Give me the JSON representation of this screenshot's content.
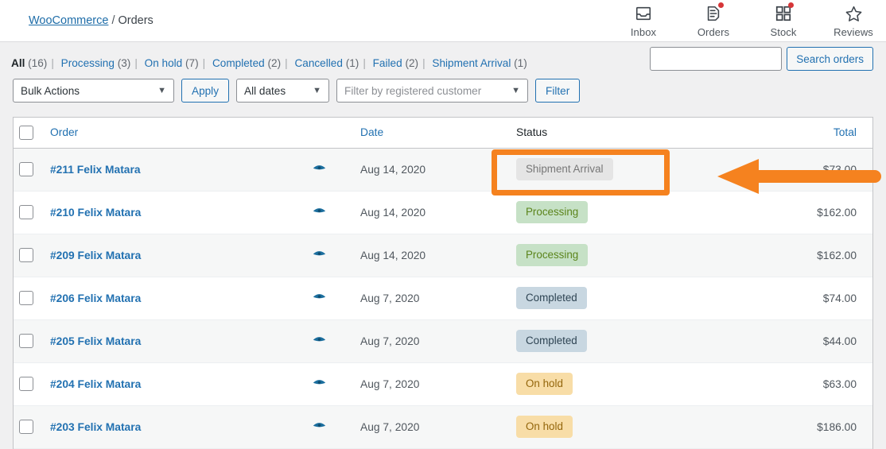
{
  "breadcrumb": {
    "root": "WooCommerce",
    "separator": "/",
    "current": "Orders"
  },
  "nav_icons": [
    {
      "label": "Inbox",
      "icon": "inbox-icon",
      "badge": false
    },
    {
      "label": "Orders",
      "icon": "orders-icon",
      "badge": true
    },
    {
      "label": "Stock",
      "icon": "stock-icon",
      "badge": true
    },
    {
      "label": "Reviews",
      "icon": "star-icon",
      "badge": false
    }
  ],
  "status_filters": [
    {
      "label": "All",
      "count": "(16)",
      "current": true
    },
    {
      "label": "Processing",
      "count": "(3)",
      "current": false
    },
    {
      "label": "On hold",
      "count": "(7)",
      "current": false
    },
    {
      "label": "Completed",
      "count": "(2)",
      "current": false
    },
    {
      "label": "Cancelled",
      "count": "(1)",
      "current": false
    },
    {
      "label": "Failed",
      "count": "(2)",
      "current": false
    },
    {
      "label": "Shipment Arrival",
      "count": "(1)",
      "current": false
    }
  ],
  "search": {
    "value": "",
    "placeholder": "",
    "button_label": "Search orders"
  },
  "toolbar": {
    "bulk_actions_label": "Bulk Actions",
    "apply_label": "Apply",
    "dates_label": "All dates",
    "customer_placeholder": "Filter by registered customer",
    "filter_label": "Filter"
  },
  "table": {
    "columns": {
      "order": "Order",
      "date": "Date",
      "status": "Status",
      "total": "Total"
    },
    "rows": [
      {
        "order": "#211 Felix Matara",
        "date": "Aug 14, 2020",
        "status": "Shipment Arrival",
        "status_kind": "shipment",
        "total": "$73.00"
      },
      {
        "order": "#210 Felix Matara",
        "date": "Aug 14, 2020",
        "status": "Processing",
        "status_kind": "processing",
        "total": "$162.00"
      },
      {
        "order": "#209 Felix Matara",
        "date": "Aug 14, 2020",
        "status": "Processing",
        "status_kind": "processing",
        "total": "$162.00"
      },
      {
        "order": "#206 Felix Matara",
        "date": "Aug 7, 2020",
        "status": "Completed",
        "status_kind": "completed",
        "total": "$74.00"
      },
      {
        "order": "#205 Felix Matara",
        "date": "Aug 7, 2020",
        "status": "Completed",
        "status_kind": "completed",
        "total": "$44.00"
      },
      {
        "order": "#204 Felix Matara",
        "date": "Aug 7, 2020",
        "status": "On hold",
        "status_kind": "onhold",
        "total": "$63.00"
      },
      {
        "order": "#203 Felix Matara",
        "date": "Aug 7, 2020",
        "status": "On hold",
        "status_kind": "onhold",
        "total": "$186.00"
      }
    ]
  },
  "annotation": {
    "color": "#f5821f",
    "highlights": "Shipment Arrival",
    "shape": "rectangle-with-left-pointing-arrow"
  },
  "colors": {
    "link": "#2271b1",
    "processing_bg": "#c6e1c6",
    "processing_fg": "#5b841b",
    "completed_bg": "#c8d7e1",
    "completed_fg": "#2e4453",
    "onhold_bg": "#f8dda7",
    "onhold_fg": "#94660c",
    "shipment_bg": "#e5e5e5",
    "shipment_fg": "#777777",
    "annotation": "#f5821f"
  }
}
